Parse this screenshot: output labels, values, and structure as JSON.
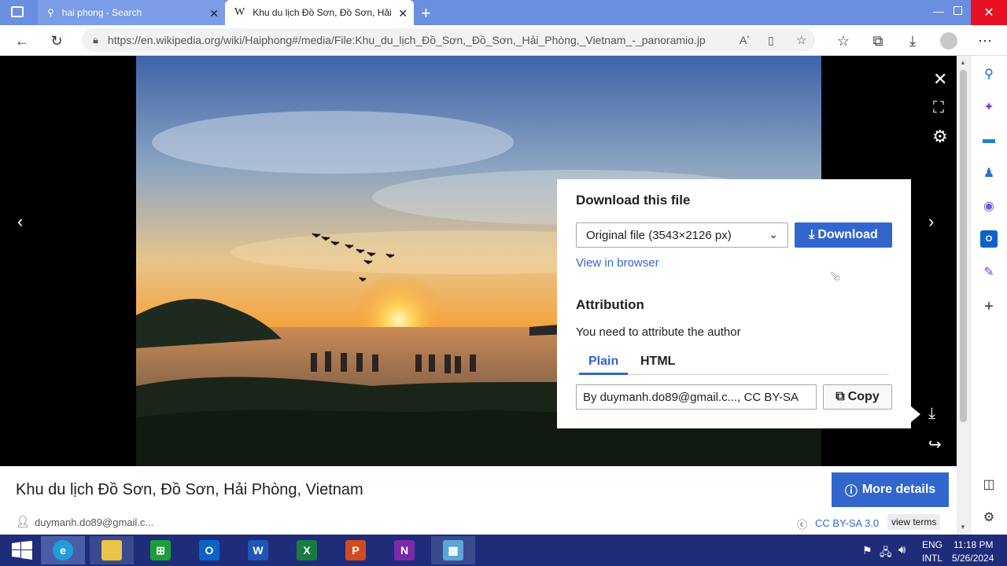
{
  "browser": {
    "tabs": [
      {
        "title": "hai phong - Search"
      },
      {
        "title": "Khu du lịch Đồ Sơn, Đồ Sơn, Hải"
      }
    ],
    "url": "https://en.wikipedia.org/wiki/Haiphong#/media/File:Khu_du_lịch_Đồ_Sơn,_Đồ_Sơn,_Hải_Phòng,_Vietnam_-_panoramio.jpg"
  },
  "download_panel": {
    "title": "Download this file",
    "select_value": "Original file (3543×2126 px)",
    "download_label": "Download",
    "view_in_browser": "View in browser",
    "attribution_title": "Attribution",
    "attribution_text": "You need to attribute the author",
    "tab_plain": "Plain",
    "tab_html": "HTML",
    "attribution_value": "By duymanh.do89@gmail.c..., CC BY-SA",
    "copy_label": "Copy"
  },
  "footer": {
    "image_title": "Khu du lịch Đồ Sơn, Đồ Sơn, Hải Phòng, Vietnam",
    "more_details": "More details",
    "author": "duymanh.do89@gmail.c...",
    "license": "CC BY-SA 3.0",
    "view_terms": "view terms"
  },
  "taskbar": {
    "lang_top": "ENG",
    "lang_bottom": "INTL",
    "time": "11:18 PM",
    "date": "5/26/2024"
  },
  "colors": {
    "accent": "#3366cc",
    "tabstrip": "#6b8fe0",
    "taskbar": "#1e2c7a"
  }
}
